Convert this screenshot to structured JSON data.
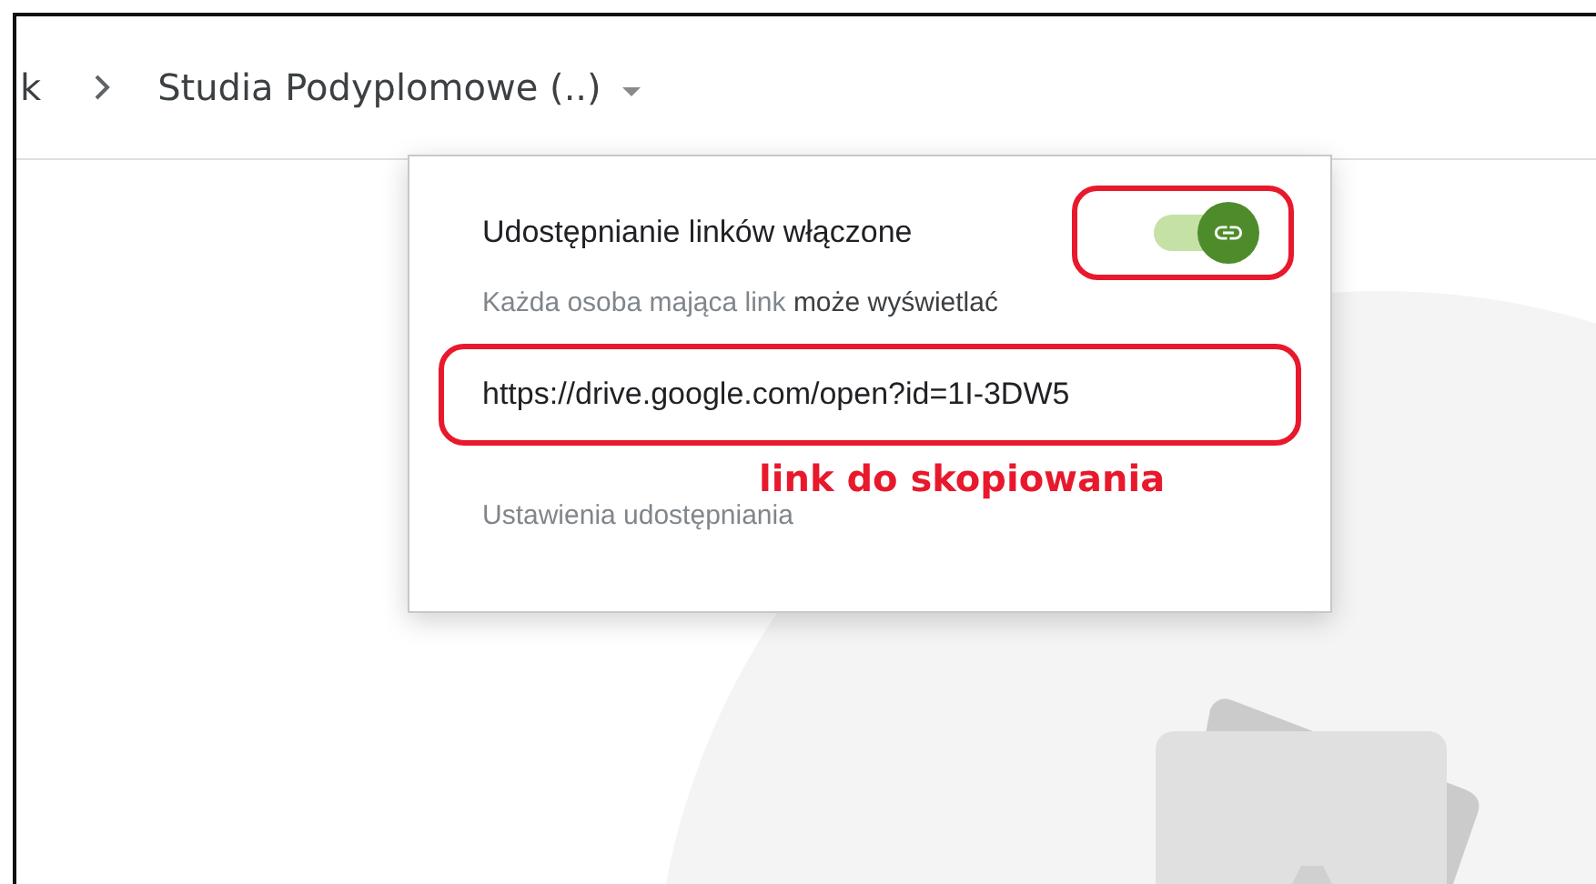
{
  "breadcrumb": {
    "items": [
      {
        "label": "k"
      },
      {
        "label": "Studia Podyplomowe (..)"
      }
    ]
  },
  "share_popup": {
    "toggle_label": "Udostępnianie linków włączone",
    "toggle": {
      "on": true
    },
    "access_text": "Każda osoba mająca link **może wyświetlać**",
    "link_field": {
      "value": "https://drive.google.com/open?id=1I-3DW5"
    },
    "settings_link": "Ustawienia udostępniania"
  },
  "annotation_note": "link do skopiowania"
}
